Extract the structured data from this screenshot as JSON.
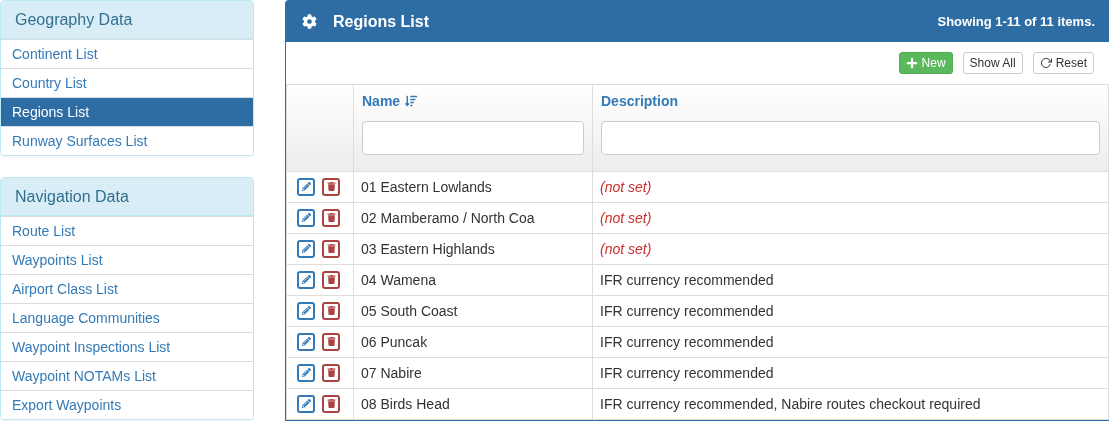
{
  "sidebar": {
    "sections": [
      {
        "title": "Geography Data",
        "items": [
          {
            "label": "Continent List",
            "selected": false
          },
          {
            "label": "Country List",
            "selected": false
          },
          {
            "label": "Regions List",
            "selected": true
          },
          {
            "label": "Runway Surfaces List",
            "selected": false
          }
        ]
      },
      {
        "title": "Navigation Data",
        "items": [
          {
            "label": "Route List",
            "selected": false
          },
          {
            "label": "Waypoints List",
            "selected": false
          },
          {
            "label": "Airport Class List",
            "selected": false
          },
          {
            "label": "Language Communities",
            "selected": false
          },
          {
            "label": "Waypoint Inspections List",
            "selected": false
          },
          {
            "label": "Waypoint NOTAMs List",
            "selected": false
          },
          {
            "label": "Export Waypoints",
            "selected": false
          }
        ]
      }
    ]
  },
  "panel": {
    "title": "Regions List",
    "summary": "Showing 1-11 of 11 items.",
    "buttons": [
      {
        "kind": "new",
        "label": "New"
      },
      {
        "kind": "show_all",
        "label": "Show All"
      },
      {
        "kind": "reset",
        "label": "Reset"
      }
    ],
    "table": {
      "columns": [
        "Name",
        "Description"
      ],
      "rows": [
        {
          "name": "01 Eastern Lowlands",
          "description": "(not set)",
          "not_set": true
        },
        {
          "name": "02 Mamberamo / North Coa",
          "description": "(not set)",
          "not_set": true
        },
        {
          "name": "03 Eastern Highlands",
          "description": "(not set)",
          "not_set": true
        },
        {
          "name": "04 Wamena",
          "description": "IFR currency recommended",
          "not_set": false
        },
        {
          "name": "05 South Coast",
          "description": "IFR currency recommended",
          "not_set": false
        },
        {
          "name": "06 Puncak",
          "description": "IFR currency recommended",
          "not_set": false
        },
        {
          "name": "07 Nabire",
          "description": "IFR currency recommended",
          "not_set": false
        },
        {
          "name": "08 Birds Head",
          "description": "IFR currency recommended, Nabire routes checkout required",
          "not_set": false
        }
      ]
    }
  }
}
